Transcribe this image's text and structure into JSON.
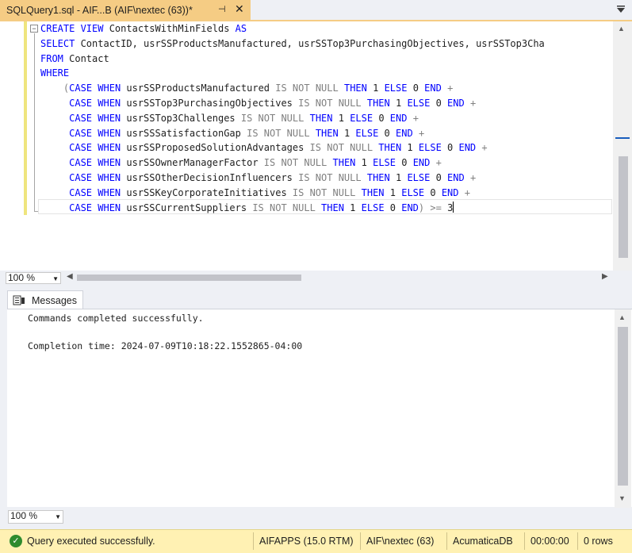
{
  "tab": {
    "title": "SQLQuery1.sql - AIF...B (AIF\\nextec (63))*",
    "pin": "⊣",
    "close": "✕"
  },
  "colors": {
    "tab_active": "#f5cc84",
    "keyword": "#0000ff",
    "operator_gray": "#808080",
    "status_bar": "#fff1b3",
    "success_green": "#2e8b2e"
  },
  "editor": {
    "lines": [
      [
        [
          "kw",
          "CREATE VIEW"
        ],
        [
          "id",
          " ContactsWithMinFields "
        ],
        [
          "kw",
          "AS"
        ]
      ],
      [
        [
          "kw",
          "SELECT"
        ],
        [
          "id",
          " ContactID, usrSSProductsManufactured, usrSSTop3PurchasingObjectives, usrSSTop3Cha"
        ]
      ],
      [
        [
          "kw",
          "FROM"
        ],
        [
          "id",
          " Contact"
        ]
      ],
      [
        [
          "kw",
          "WHERE"
        ]
      ],
      [
        [
          "id",
          "    "
        ],
        [
          "gr",
          "("
        ],
        [
          "kw",
          "CASE WHEN"
        ],
        [
          "id",
          " usrSSProductsManufactured "
        ],
        [
          "gr",
          "IS NOT NULL"
        ],
        [
          "id",
          " "
        ],
        [
          "kw",
          "THEN"
        ],
        [
          "id",
          " 1 "
        ],
        [
          "kw",
          "ELSE"
        ],
        [
          "id",
          " 0 "
        ],
        [
          "kw",
          "END"
        ],
        [
          "id",
          " "
        ],
        [
          "gr",
          "+"
        ]
      ],
      [
        [
          "id",
          "     "
        ],
        [
          "kw",
          "CASE WHEN"
        ],
        [
          "id",
          " usrSSTop3PurchasingObjectives "
        ],
        [
          "gr",
          "IS NOT NULL"
        ],
        [
          "id",
          " "
        ],
        [
          "kw",
          "THEN"
        ],
        [
          "id",
          " 1 "
        ],
        [
          "kw",
          "ELSE"
        ],
        [
          "id",
          " 0 "
        ],
        [
          "kw",
          "END"
        ],
        [
          "id",
          " "
        ],
        [
          "gr",
          "+"
        ]
      ],
      [
        [
          "id",
          "     "
        ],
        [
          "kw",
          "CASE WHEN"
        ],
        [
          "id",
          " usrSSTop3Challenges "
        ],
        [
          "gr",
          "IS NOT NULL"
        ],
        [
          "id",
          " "
        ],
        [
          "kw",
          "THEN"
        ],
        [
          "id",
          " 1 "
        ],
        [
          "kw",
          "ELSE"
        ],
        [
          "id",
          " 0 "
        ],
        [
          "kw",
          "END"
        ],
        [
          "id",
          " "
        ],
        [
          "gr",
          "+"
        ]
      ],
      [
        [
          "id",
          "     "
        ],
        [
          "kw",
          "CASE WHEN"
        ],
        [
          "id",
          " usrSSSatisfactionGap "
        ],
        [
          "gr",
          "IS NOT NULL"
        ],
        [
          "id",
          " "
        ],
        [
          "kw",
          "THEN"
        ],
        [
          "id",
          " 1 "
        ],
        [
          "kw",
          "ELSE"
        ],
        [
          "id",
          " 0 "
        ],
        [
          "kw",
          "END"
        ],
        [
          "id",
          " "
        ],
        [
          "gr",
          "+"
        ]
      ],
      [
        [
          "id",
          "     "
        ],
        [
          "kw",
          "CASE WHEN"
        ],
        [
          "id",
          " usrSSProposedSolutionAdvantages "
        ],
        [
          "gr",
          "IS NOT NULL"
        ],
        [
          "id",
          " "
        ],
        [
          "kw",
          "THEN"
        ],
        [
          "id",
          " 1 "
        ],
        [
          "kw",
          "ELSE"
        ],
        [
          "id",
          " 0 "
        ],
        [
          "kw",
          "END"
        ],
        [
          "id",
          " "
        ],
        [
          "gr",
          "+"
        ]
      ],
      [
        [
          "id",
          "     "
        ],
        [
          "kw",
          "CASE WHEN"
        ],
        [
          "id",
          " usrSSOwnerManagerFactor "
        ],
        [
          "gr",
          "IS NOT NULL"
        ],
        [
          "id",
          " "
        ],
        [
          "kw",
          "THEN"
        ],
        [
          "id",
          " 1 "
        ],
        [
          "kw",
          "ELSE"
        ],
        [
          "id",
          " 0 "
        ],
        [
          "kw",
          "END"
        ],
        [
          "id",
          " "
        ],
        [
          "gr",
          "+"
        ]
      ],
      [
        [
          "id",
          "     "
        ],
        [
          "kw",
          "CASE WHEN"
        ],
        [
          "id",
          " usrSSOtherDecisionInfluencers "
        ],
        [
          "gr",
          "IS NOT NULL"
        ],
        [
          "id",
          " "
        ],
        [
          "kw",
          "THEN"
        ],
        [
          "id",
          " 1 "
        ],
        [
          "kw",
          "ELSE"
        ],
        [
          "id",
          " 0 "
        ],
        [
          "kw",
          "END"
        ],
        [
          "id",
          " "
        ],
        [
          "gr",
          "+"
        ]
      ],
      [
        [
          "id",
          "     "
        ],
        [
          "kw",
          "CASE WHEN"
        ],
        [
          "id",
          " usrSSKeyCorporateInitiatives "
        ],
        [
          "gr",
          "IS NOT NULL"
        ],
        [
          "id",
          " "
        ],
        [
          "kw",
          "THEN"
        ],
        [
          "id",
          " 1 "
        ],
        [
          "kw",
          "ELSE"
        ],
        [
          "id",
          " 0 "
        ],
        [
          "kw",
          "END"
        ],
        [
          "id",
          " "
        ],
        [
          "gr",
          "+"
        ]
      ],
      [
        [
          "id",
          "     "
        ],
        [
          "kw",
          "CASE WHEN"
        ],
        [
          "id",
          " usrSSCurrentSuppliers "
        ],
        [
          "gr",
          "IS NOT NULL"
        ],
        [
          "id",
          " "
        ],
        [
          "kw",
          "THEN"
        ],
        [
          "id",
          " 1 "
        ],
        [
          "kw",
          "ELSE"
        ],
        [
          "id",
          " 0 "
        ],
        [
          "kw",
          "END"
        ],
        [
          "gr",
          ")"
        ],
        [
          "id",
          " "
        ],
        [
          "gr",
          ">="
        ],
        [
          "id",
          " 3"
        ]
      ]
    ],
    "zoom": "100 %"
  },
  "results": {
    "tab_label": "Messages",
    "messages": [
      "Commands completed successfully.",
      "",
      "Completion time: 2024-07-09T10:18:22.1552865-04:00"
    ],
    "zoom": "100 %"
  },
  "statusbar": {
    "message": "Query executed successfully.",
    "server": "AIFAPPS (15.0 RTM)",
    "user": "AIF\\nextec (63)",
    "database": "AcumaticaDB",
    "elapsed": "00:00:00",
    "rows": "0 rows"
  }
}
